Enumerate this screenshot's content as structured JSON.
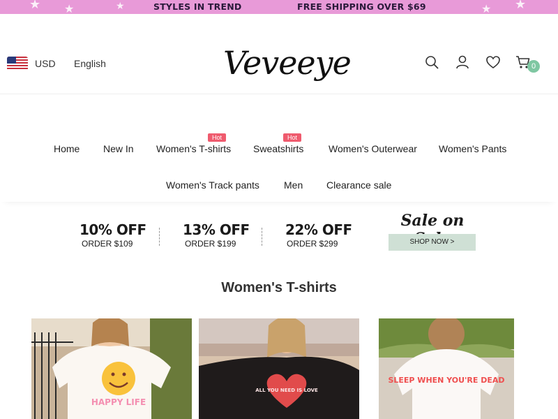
{
  "promo": {
    "message_left": "STYLES IN TREND",
    "message_right": "FREE SHIPPING OVER $69",
    "background": "#e89ad8"
  },
  "header": {
    "currency": "USD",
    "language": "English",
    "logo_text": "Veveeye",
    "cart_count": "0",
    "icons": [
      "search-icon",
      "account-icon",
      "heart-icon",
      "cart-icon"
    ]
  },
  "nav": {
    "items": [
      {
        "label": "Home"
      },
      {
        "label": "New In"
      },
      {
        "label": "Women's T-shirts",
        "badge": "Hot"
      },
      {
        "label": "Sweatshirts",
        "badge": "Hot"
      },
      {
        "label": "Women's Outerwear"
      },
      {
        "label": "Women's Pants"
      },
      {
        "label": "Women's Track pants"
      },
      {
        "label": "Men"
      },
      {
        "label": "Clearance sale"
      }
    ]
  },
  "sale": {
    "deals": [
      {
        "off": "10% OFF",
        "order": "ORDER $109"
      },
      {
        "off": "13% OFF",
        "order": "ORDER $199"
      },
      {
        "off": "22% OFF",
        "order": "ORDER $299"
      }
    ],
    "headline": "Sale on Sale",
    "cta": "SHOP NOW >"
  },
  "section": {
    "title": "Women's T-shirts"
  },
  "products": [
    {
      "print_text": "HAPPY LIFE"
    },
    {
      "print_text": "ALL YOU NEED IS LOVE"
    },
    {
      "print_text": "SLEEP WHEN YOU'RE DEAD"
    }
  ],
  "colors": {
    "hot_badge": "#ef5b6e",
    "cart_badge": "#7fc7a2",
    "cta_background": "#cfe0d5"
  }
}
